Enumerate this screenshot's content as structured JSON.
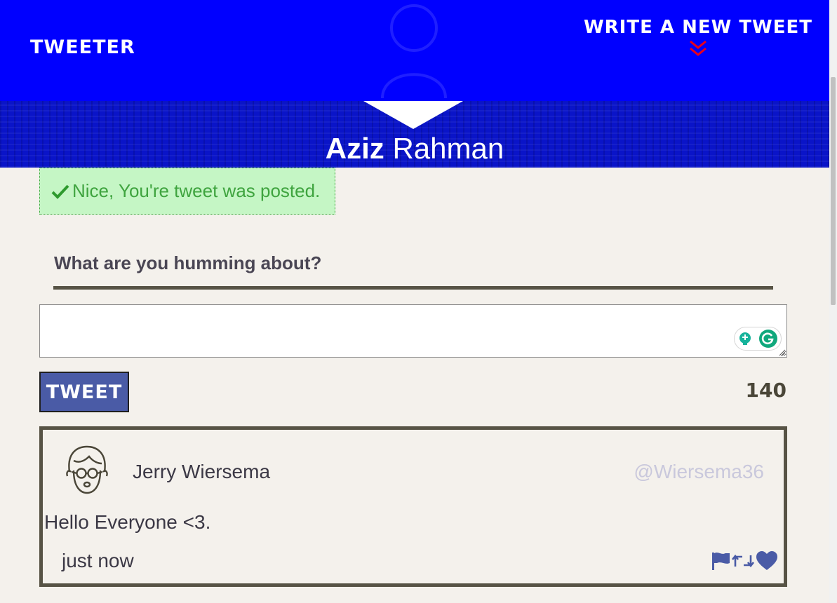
{
  "nav": {
    "brand": "TWEETER",
    "write_link": "WRITE A NEW TWEET"
  },
  "profile": {
    "first_name": "Aziz",
    "last_name": "Rahman"
  },
  "flash": {
    "message": "Nice, You're tweet was posted."
  },
  "compose": {
    "title": "What are you humming about?",
    "input_value": "",
    "button_label": "TWEET",
    "counter": "140"
  },
  "tweets": [
    {
      "name": "Jerry Wiersema",
      "handle": "@Wiersema36",
      "text": "Hello Everyone <3.",
      "time": "just now"
    }
  ],
  "colors": {
    "nav_bg": "#0000ff",
    "band_bg": "#0a14c8",
    "accent": "#4a5ba6",
    "chevron": "#e8001c",
    "flash_bg": "#c5f6c5",
    "card_border": "#575345",
    "handle": "#c9c8dc"
  },
  "icons": {
    "write_toggle": "double-chevron-down-icon",
    "flash": "checkmark-icon",
    "avatar": "user-glasses-avatar-icon",
    "flag": "flag-icon",
    "retweet": "retweet-icon",
    "like": "heart-icon"
  }
}
